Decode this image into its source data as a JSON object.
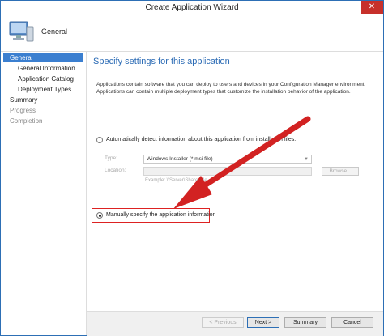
{
  "window": {
    "title": "Create Application Wizard",
    "close_glyph": "✕"
  },
  "header": {
    "page_title": "General",
    "icon": "computer-icon"
  },
  "sidebar": {
    "items": [
      {
        "label": "General"
      },
      {
        "label": "General Information"
      },
      {
        "label": "Application Catalog"
      },
      {
        "label": "Deployment Types"
      },
      {
        "label": "Summary"
      },
      {
        "label": "Progress"
      },
      {
        "label": "Completion"
      }
    ]
  },
  "content": {
    "heading": "Specify settings for this application",
    "description": "Applications contain software that you can deploy to users and devices in your Configuration Manager environment. Applications can contain multiple deployment types that customize the installation behavior of the application.",
    "auto_detect": {
      "label": "Automatically detect information about this application from installation files:",
      "type_label": "Type:",
      "type_value": "Windows Installer (*.msi file)",
      "location_label": "Location:",
      "location_value": "",
      "browse_label": "Browse...",
      "example": "Example: \\\\Server\\Share\\File"
    },
    "manual": {
      "label": "Manually specify the application information",
      "selected": true
    }
  },
  "footer": {
    "previous": "< Previous",
    "next": "Next >",
    "summary": "Summary",
    "cancel": "Cancel"
  },
  "colors": {
    "accent": "#2b6bb5",
    "annotation": "#d22222",
    "selection": "#3b7fd0"
  }
}
